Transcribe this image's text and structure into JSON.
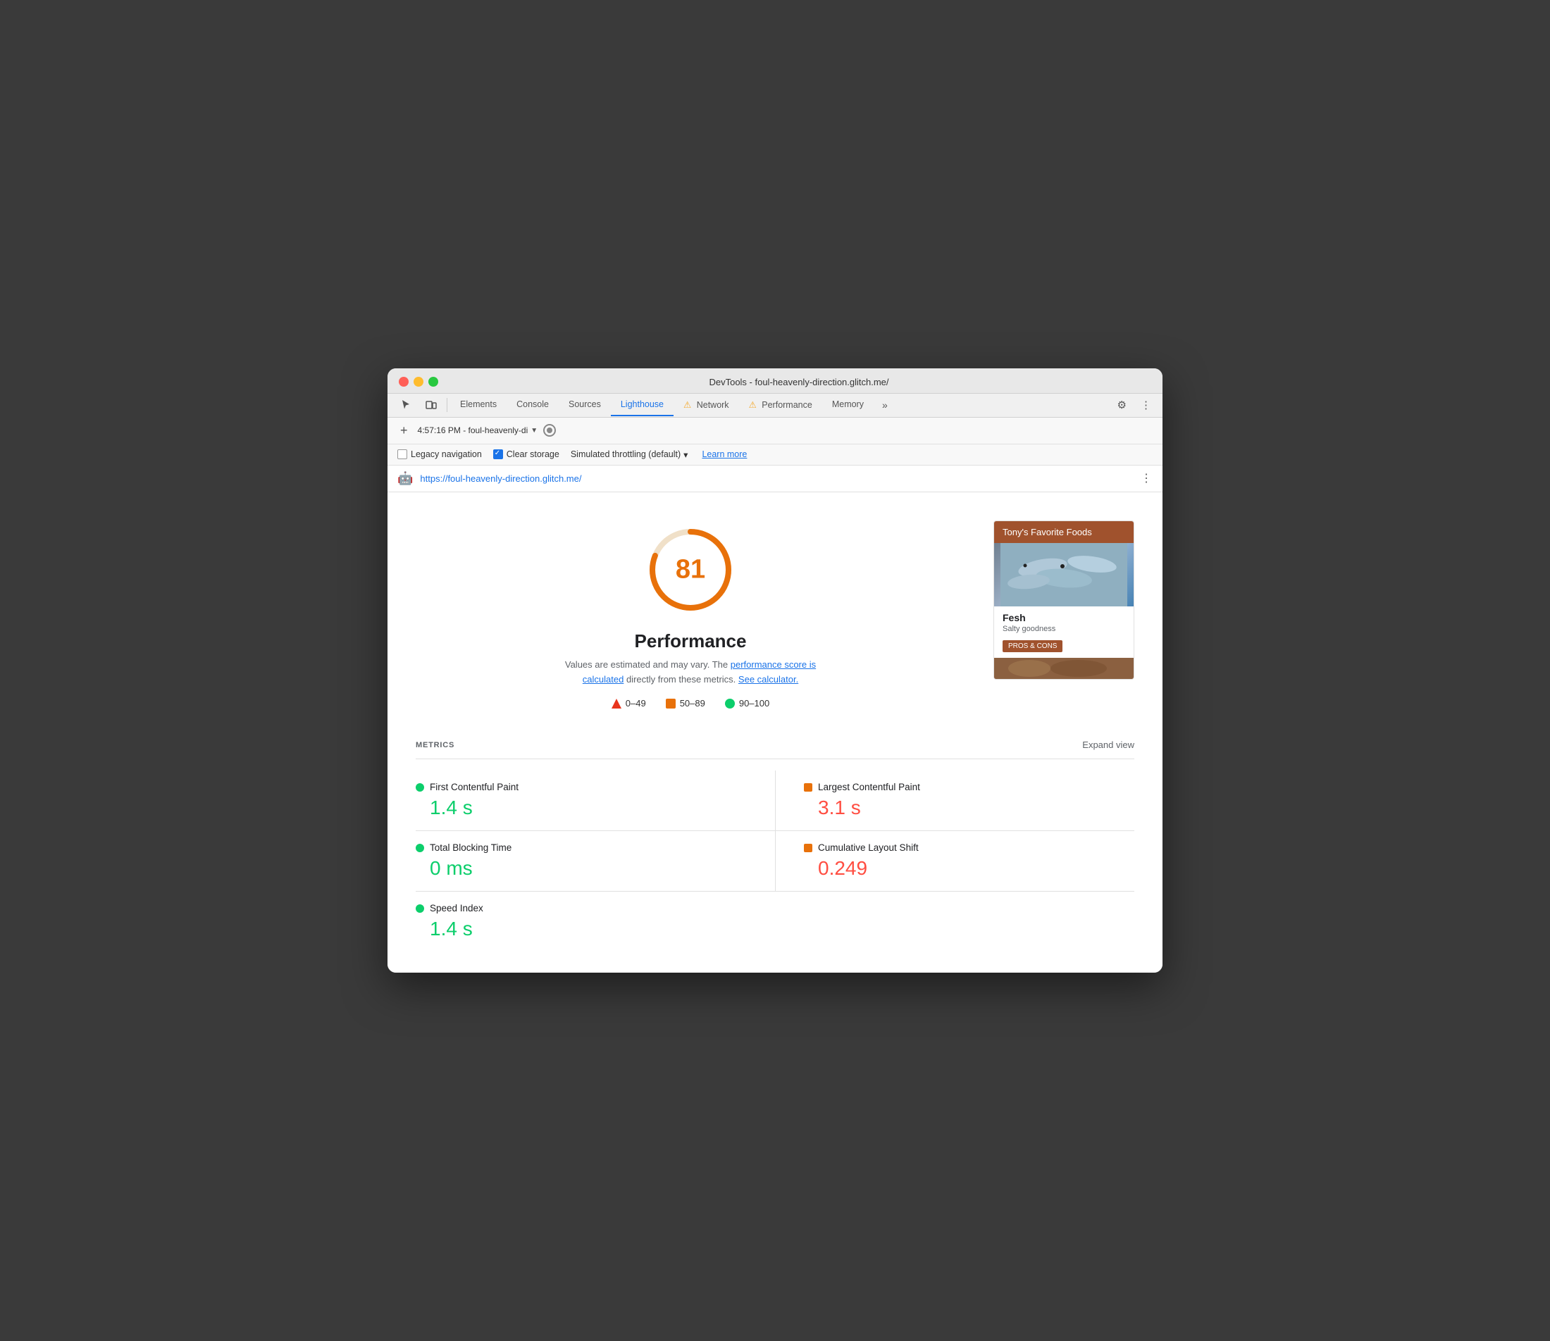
{
  "window": {
    "title": "DevTools - foul-heavenly-direction.glitch.me/"
  },
  "tabs": {
    "elements": "Elements",
    "console": "Console",
    "sources": "Sources",
    "lighthouse": "Lighthouse",
    "network": "Network",
    "performance": "Performance",
    "memory": "Memory",
    "more": "»"
  },
  "secondary_toolbar": {
    "timestamp": "4:57:16 PM - foul-heavenly-di",
    "add_label": "+"
  },
  "options": {
    "legacy_nav_label": "Legacy navigation",
    "clear_storage_label": "Clear storage",
    "throttling_label": "Simulated throttling (default)",
    "throttle_arrow": "▾",
    "learn_more": "Learn more"
  },
  "url_bar": {
    "url": "https://foul-heavenly-direction.glitch.me/"
  },
  "score_section": {
    "score": "81",
    "title": "Performance",
    "description_text": "Values are estimated and may vary. The",
    "link1": "performance score is calculated",
    "description_mid": "directly from these metrics.",
    "link2": "See calculator.",
    "legend": {
      "range1": "0–49",
      "range2": "50–89",
      "range3": "90–100"
    }
  },
  "preview": {
    "header": "Tony's Favorite Foods",
    "item_name": "Fesh",
    "item_desc": "Salty goodness",
    "pros_cons_btn": "PROS & CONS"
  },
  "metrics": {
    "section_label": "METRICS",
    "expand_label": "Expand view",
    "items": [
      {
        "name": "First Contentful Paint",
        "value": "1.4 s",
        "color": "green",
        "shape": "dot"
      },
      {
        "name": "Largest Contentful Paint",
        "value": "3.1 s",
        "color": "orange",
        "shape": "square"
      },
      {
        "name": "Total Blocking Time",
        "value": "0 ms",
        "color": "green",
        "shape": "dot"
      },
      {
        "name": "Cumulative Layout Shift",
        "value": "0.249",
        "color": "orange",
        "shape": "square"
      },
      {
        "name": "Speed Index",
        "value": "1.4 s",
        "color": "green",
        "shape": "dot"
      }
    ]
  }
}
